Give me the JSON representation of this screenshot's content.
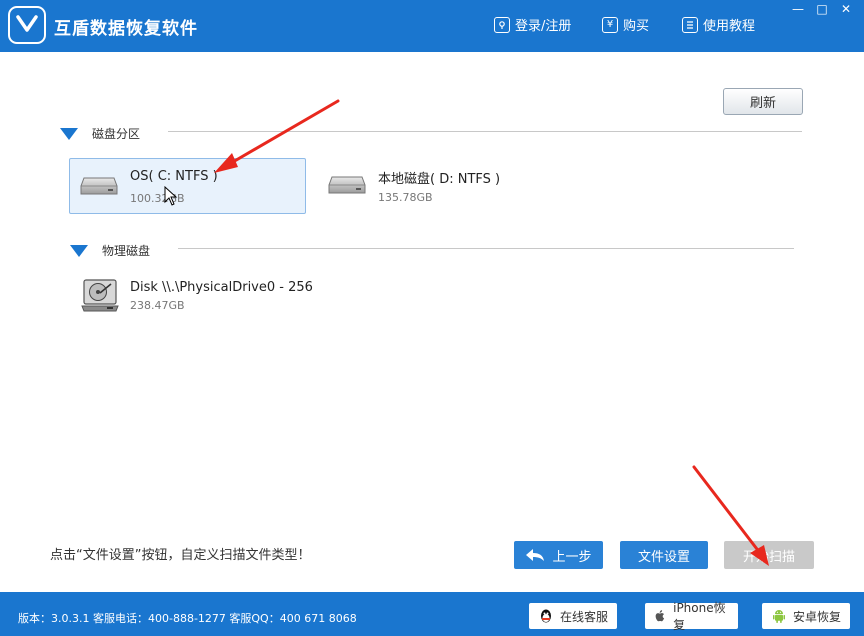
{
  "app": {
    "title": "互盾数据恢复软件"
  },
  "titlebar": {
    "login": "登录/注册",
    "buy": "购买",
    "tutorial": "使用教程",
    "buy_icon_glyph": "¥",
    "minimize": "—",
    "maximize": "□",
    "close": "✕"
  },
  "toolbar": {
    "refresh": "刷新"
  },
  "partitions": {
    "heading": "磁盘分区",
    "items": [
      {
        "name": "OS( C: NTFS )",
        "size": "100.32GB",
        "selected": true
      },
      {
        "name": "本地磁盘( D: NTFS )",
        "size": "135.78GB",
        "selected": false
      }
    ]
  },
  "physical": {
    "heading": "物理磁盘",
    "items": [
      {
        "name": "Disk \\\\.\\PhysicalDrive0 - 256",
        "size": "238.47GB"
      }
    ]
  },
  "bottom": {
    "tip": "点击“文件设置”按钮，自定义扫描文件类型！",
    "back": "上一步",
    "file_settings": "文件设置",
    "start_scan": "开始扫描"
  },
  "footer": {
    "info": "版本：3.0.3.1  客服电话：400-888-1277    客服QQ：400 671 8068",
    "online_service": "在线客服",
    "iphone_recovery": "iPhone恢复",
    "android_recovery": "安卓恢复"
  },
  "colors": {
    "brand_blue": "#1a76cf",
    "button_blue": "#2a82d6",
    "disabled_gray": "#c9c9c9",
    "annotation_red": "#e8281e"
  },
  "icons": [
    "shield-logo-icon",
    "login-icon",
    "yen-icon",
    "book-icon",
    "hdd-icon",
    "hard-disk-icon",
    "back-arrow-icon",
    "qq-icon",
    "apple-icon",
    "android-icon",
    "mouse-cursor-icon"
  ]
}
